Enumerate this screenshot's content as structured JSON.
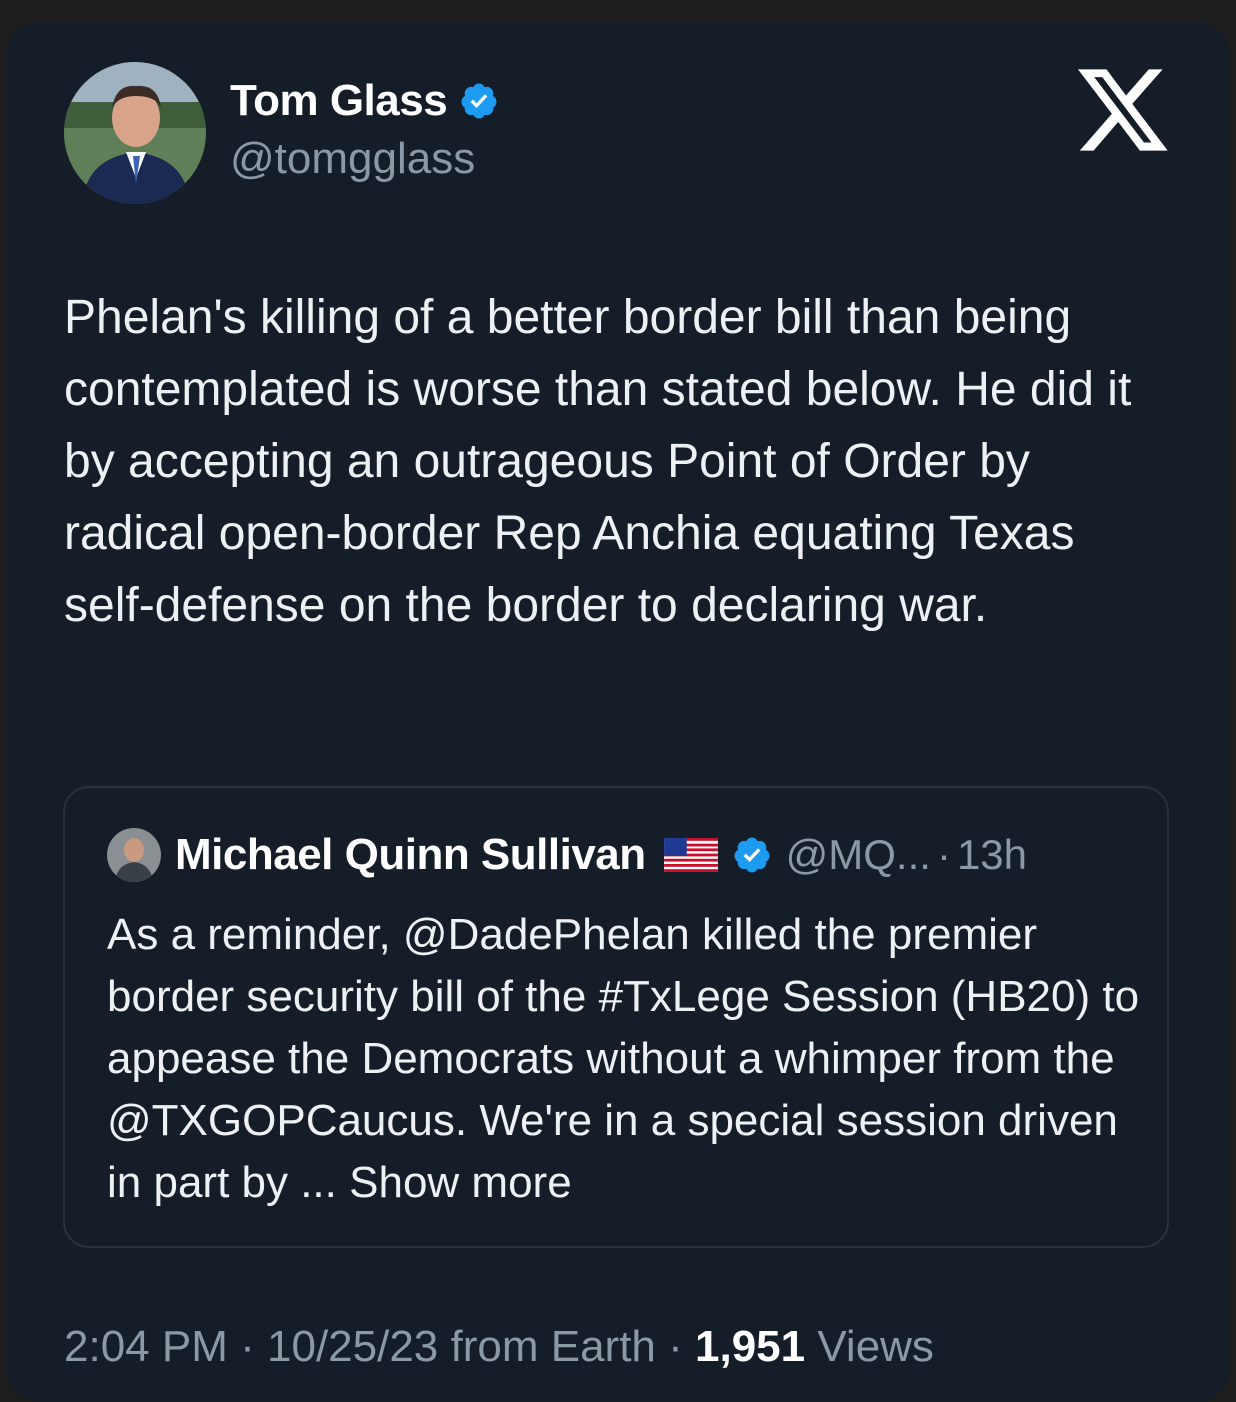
{
  "author": {
    "name": "Tom Glass",
    "handle": "@tomgglass",
    "verified": true
  },
  "x_logo_icon": "x-logo-icon",
  "tweet_text": "Phelan's killing of a better border bill than being contemplated is worse than stated below. He did it by accepting an outrageous Point of Order by radical open-border Rep Anchia equating Texas self-defense on the border to declaring war.",
  "quoted_tweet": {
    "name": "Michael Quinn Sullivan",
    "flag_icon": "us-flag-icon",
    "verified": true,
    "handle": "@MQ...",
    "separator": "·",
    "time": "13h",
    "text": "As a reminder, @DadePhelan killed the premier border security bill of the #TxLege Session (HB20) to appease the Democrats without a whimper from the @TXGOPCaucus. We're in a special session driven in part by ...",
    "show_more": "Show more"
  },
  "footer": {
    "time": "2:04 PM",
    "sep1": "·",
    "date": "10/25/23 from Earth",
    "sep2": "·",
    "views_count": "1,951",
    "views_label": "Views"
  },
  "colors": {
    "background": "#151d28",
    "text": "#eef1f3",
    "muted": "#8b98a5",
    "verified_blue": "#1d9bf0"
  }
}
